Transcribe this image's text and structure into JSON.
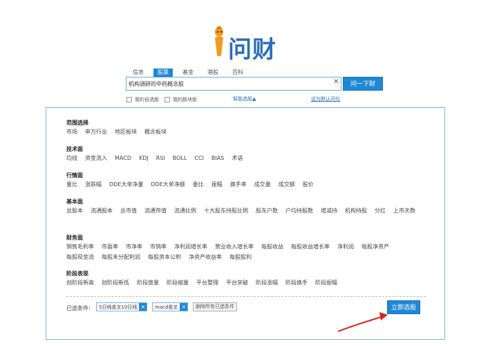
{
  "brand": {
    "logo_text": "问财",
    "accent": "#1e88d6",
    "mascot_color": "#f39a1e"
  },
  "tabs": [
    {
      "label": "信息",
      "active": false
    },
    {
      "label": "股票",
      "active": true
    },
    {
      "label": "基金",
      "active": false
    },
    {
      "label": "港股",
      "active": false
    },
    {
      "label": "百科",
      "active": false
    }
  ],
  "search": {
    "value": "机构调研的中药概念股",
    "clear_icon": "close-icon",
    "button_label": "问一下财"
  },
  "options": {
    "my_watchlist": "我的自选股",
    "my_sectors": "我的板块股",
    "smart_pick": "智能选股▲",
    "set_default": "设为默认问句"
  },
  "categories": [
    {
      "title": "范围选择",
      "items": [
        "市场",
        "申万行业",
        "地区板块",
        "概念板块"
      ]
    },
    {
      "title": "技术面",
      "items": [
        "均线",
        "资金流入",
        "MACD",
        "KDJ",
        "RSI",
        "BOLL",
        "CCI",
        "BIAS",
        "术语"
      ]
    },
    {
      "title": "行情面",
      "items": [
        "量比",
        "涨跌幅",
        "DDE大单净量",
        "DDE大单净额",
        "委比",
        "振幅",
        "换手率",
        "成交量",
        "成交额",
        "股价"
      ]
    },
    {
      "title": "基本面",
      "items": [
        "总股本",
        "流通股本",
        "总市值",
        "流通市值",
        "流通比例",
        "十大股东持股比例",
        "股东户数",
        "户均持股数",
        "增减持",
        "机构持股",
        "分红",
        "上市天数"
      ]
    },
    {
      "title": "财务面",
      "items": [
        "销售毛利率",
        "市盈率",
        "市净率",
        "市销率",
        "净利润增长率",
        "营业收入增长率",
        "每股收益",
        "每股收益增长率",
        "净利润",
        "每股净资产",
        "每股现金流",
        "每股未分配利润",
        "每股资本公积",
        "净资产收益率",
        "每股股利"
      ]
    },
    {
      "title": "阶段表现",
      "items": [
        "创阶段新高",
        "创阶段新低",
        "阶段放量",
        "阶段缩量",
        "平台整理",
        "平台突破",
        "阶段涨幅",
        "阶段换手",
        "阶段振幅"
      ]
    }
  ],
  "selected": {
    "label": "已选条件:",
    "chips": [
      "5日线金叉10日线",
      "macd金叉"
    ],
    "clear_all": "删除所有已选条件"
  },
  "go_button": "立即选股"
}
